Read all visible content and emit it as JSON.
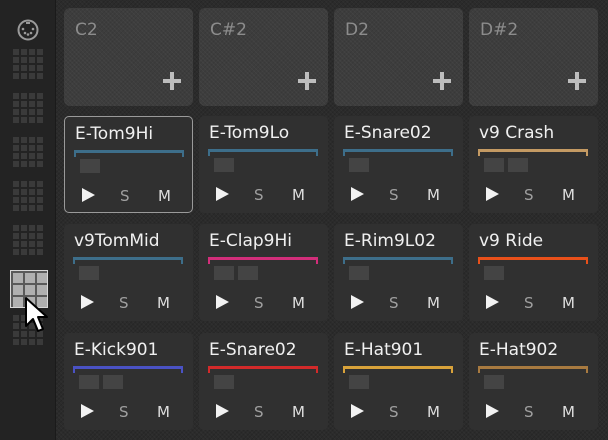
{
  "sidebar": {
    "midi_icon": "midi-port-icon",
    "grid_icon": "drum-grid-icon",
    "cursor_icon": "mouse-pointer-icon"
  },
  "empty_pads": [
    {
      "note": "C2",
      "add_icon": "plus-icon"
    },
    {
      "note": "C#2",
      "add_icon": "plus-icon"
    },
    {
      "note": "D2",
      "add_icon": "plus-icon"
    },
    {
      "note": "D#2",
      "add_icon": "plus-icon"
    }
  ],
  "pads": [
    {
      "name": "E-Tom9Hi",
      "color": "#3d6e8a",
      "selected": true,
      "slots": 1
    },
    {
      "name": "E-Tom9Lo",
      "color": "#3d6e8a",
      "selected": false,
      "slots": 1
    },
    {
      "name": "E-Snare02",
      "color": "#3d6e8a",
      "selected": false,
      "slots": 1
    },
    {
      "name": "v9 Crash",
      "color": "#c49a63",
      "selected": false,
      "slots": 2
    },
    {
      "name": "v9TomMid",
      "color": "#3d6e8a",
      "selected": false,
      "slots": 1
    },
    {
      "name": "E-Clap9Hi",
      "color": "#d22e7a",
      "selected": false,
      "slots": 2
    },
    {
      "name": "E-Rim9L02",
      "color": "#3d6e8a",
      "selected": false,
      "slots": 1
    },
    {
      "name": "v9 Ride",
      "color": "#e8501a",
      "selected": false,
      "slots": 1
    },
    {
      "name": "E-Kick901",
      "color": "#4a52c4",
      "selected": false,
      "slots": 2
    },
    {
      "name": "E-Snare02",
      "color": "#d22a2a",
      "selected": false,
      "slots": 1
    },
    {
      "name": "E-Hat901",
      "color": "#d8a23a",
      "selected": false,
      "slots": 1
    },
    {
      "name": "E-Hat902",
      "color": "#a87a40",
      "selected": false,
      "slots": 1
    }
  ],
  "controls": {
    "play_icon": "play-icon",
    "solo_label": "S",
    "mute_label": "M"
  }
}
